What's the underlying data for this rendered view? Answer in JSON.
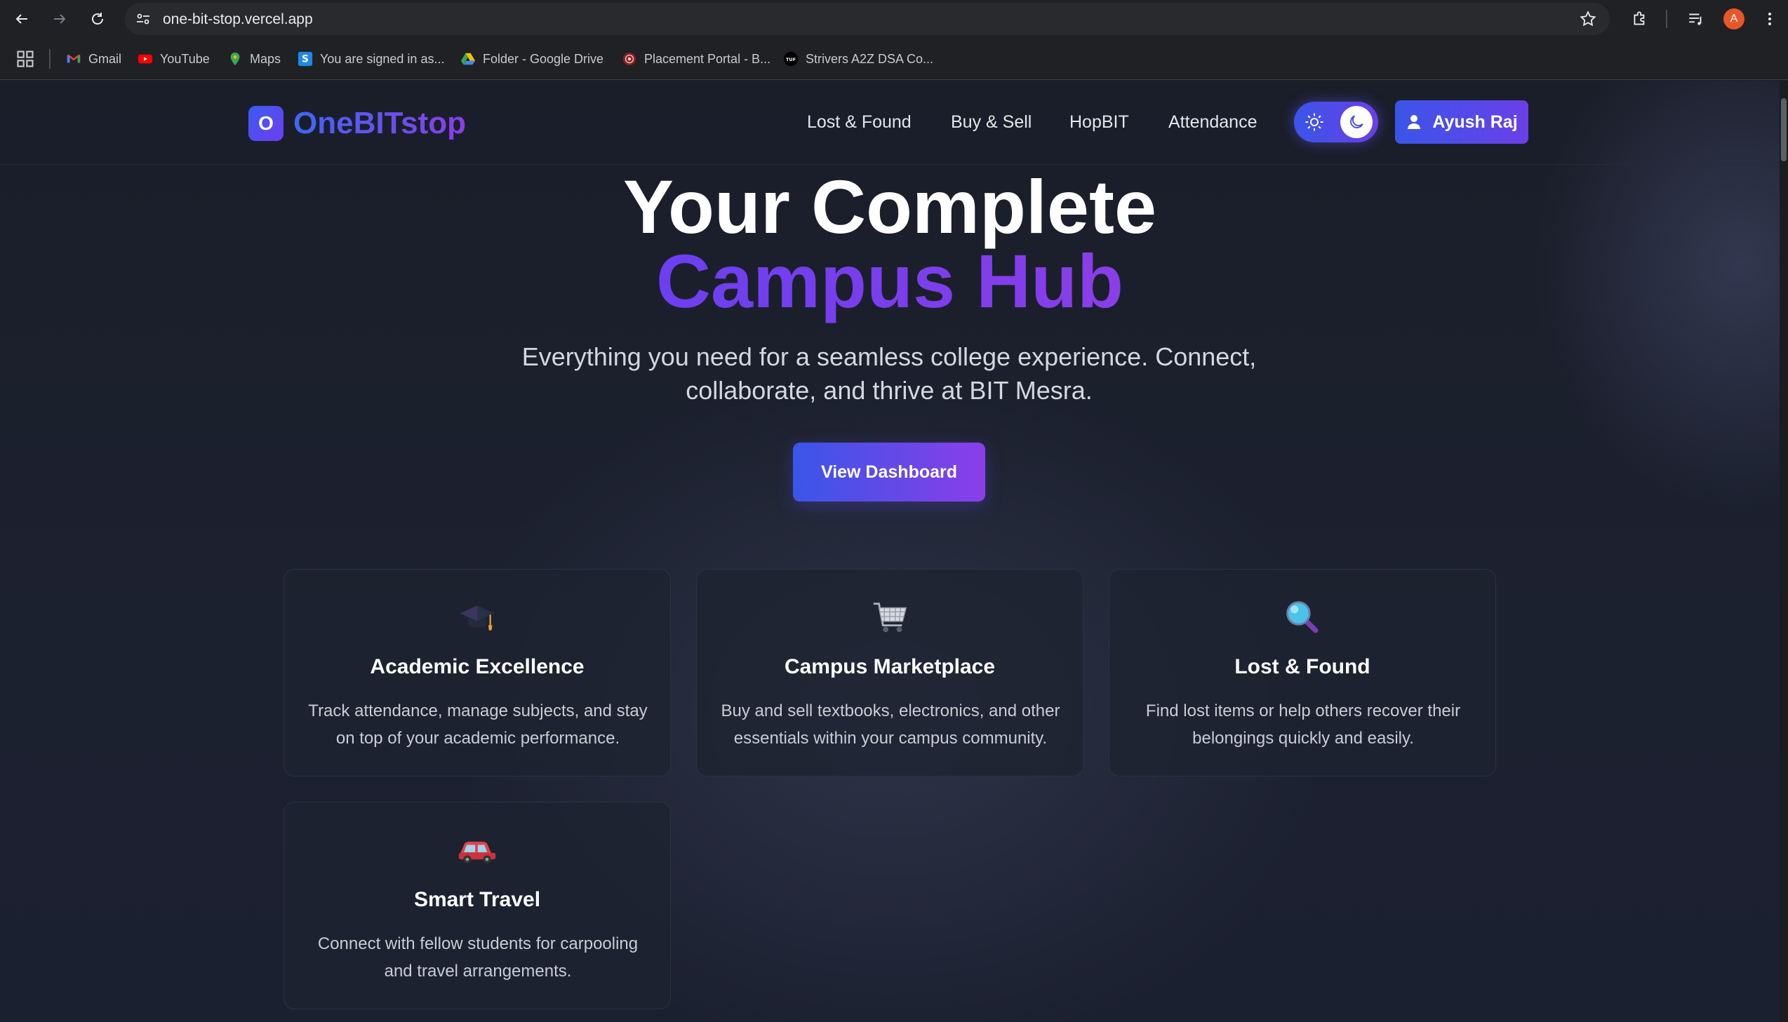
{
  "browser": {
    "url": "one-bit-stop.vercel.app",
    "profile_initial": "A",
    "bookmarks": [
      {
        "label": "Gmail",
        "icon": "gmail-icon"
      },
      {
        "label": "YouTube",
        "icon": "youtube-icon"
      },
      {
        "label": "Maps",
        "icon": "maps-icon"
      },
      {
        "label": "You are signed in as...",
        "icon": "s-logo-icon"
      },
      {
        "label": "Folder - Google Drive",
        "icon": "google-drive-icon"
      },
      {
        "label": "Placement Portal - B...",
        "icon": "placement-portal-icon"
      },
      {
        "label": "Strivers A2Z DSA Co...",
        "icon": "tuf-icon"
      }
    ]
  },
  "header": {
    "logo_letter": "O",
    "logo_text": "OneBITstop",
    "nav": [
      "Lost & Found",
      "Buy & Sell",
      "HopBIT",
      "Attendance"
    ],
    "user_name": "Ayush Raj"
  },
  "hero": {
    "line1": "Your Complete",
    "line2": "Campus Hub",
    "subtitle": "Everything you need for a seamless college experience. Connect, collaborate, and thrive at BIT Mesra.",
    "cta": "View Dashboard"
  },
  "features": [
    {
      "icon": "graduation-cap-icon",
      "title": "Academic Excellence",
      "desc": "Track attendance, manage subjects, and stay on top of your academic performance."
    },
    {
      "icon": "shopping-cart-icon",
      "title": "Campus Marketplace",
      "desc": "Buy and sell textbooks, electronics, and other essentials within your campus community."
    },
    {
      "icon": "magnifying-glass-icon",
      "title": "Lost & Found",
      "desc": "Find lost items or help others recover their belongings quickly and easily."
    },
    {
      "icon": "car-icon",
      "title": "Smart Travel",
      "desc": "Connect with fellow students for carpooling and travel arrangements."
    }
  ],
  "colors": {
    "accent_blue": "#3a55e8",
    "accent_purple": "#8a3ee8",
    "background": "#1b1f2a"
  }
}
